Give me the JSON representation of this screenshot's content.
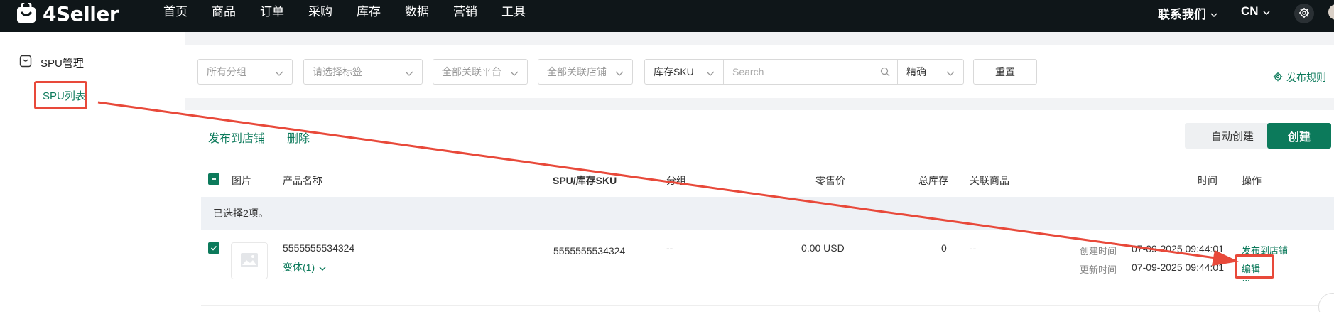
{
  "header": {
    "logo_text": "4Seller",
    "nav": [
      "首页",
      "商品",
      "订单",
      "采购",
      "库存",
      "数据",
      "营销",
      "工具"
    ],
    "contact_label": "联系我们",
    "lang_label": "CN"
  },
  "sidebar": {
    "group_label": "SPU管理",
    "item_label": "SPU列表"
  },
  "filters": {
    "group_placeholder": "所有分组",
    "tag_placeholder": "请选择标签",
    "platform_placeholder": "全部关联平台",
    "store_placeholder": "全部关联店铺",
    "search_field": "库存SKU",
    "search_placeholder": "Search",
    "match_mode": "精确",
    "reset_label": "重置",
    "rules_label": "发布规则"
  },
  "toolbar": {
    "publish_label": "发布到店铺",
    "delete_label": "删除",
    "auto_create_label": "自动创建",
    "create_label": "创建"
  },
  "table": {
    "headers": {
      "image": "图片",
      "name": "产品名称",
      "spu": "SPU/库存SKU",
      "group": "分组",
      "price": "零售价",
      "stock": "总库存",
      "linked": "关联商品",
      "time": "时间",
      "actions": "操作"
    },
    "selection_text": "已选择2项。",
    "rows": [
      {
        "name": "5555555534324",
        "variant_label": "变体(1)",
        "spu": "5555555534324",
        "group": "--",
        "price": "0.00 USD",
        "stock": "0",
        "linked": "--",
        "created_label": "创建时间",
        "created_time": "07-09-2025 09:44:01",
        "updated_label": "更新时间",
        "updated_time": "07-09-2025 09:44:01",
        "action_publish": "发布到店铺",
        "action_edit": "编辑",
        "action_more": "..."
      }
    ]
  },
  "colors": {
    "brand": "#0c7a5b",
    "topbar": "#0f1619",
    "annotation": "#e8493a"
  }
}
